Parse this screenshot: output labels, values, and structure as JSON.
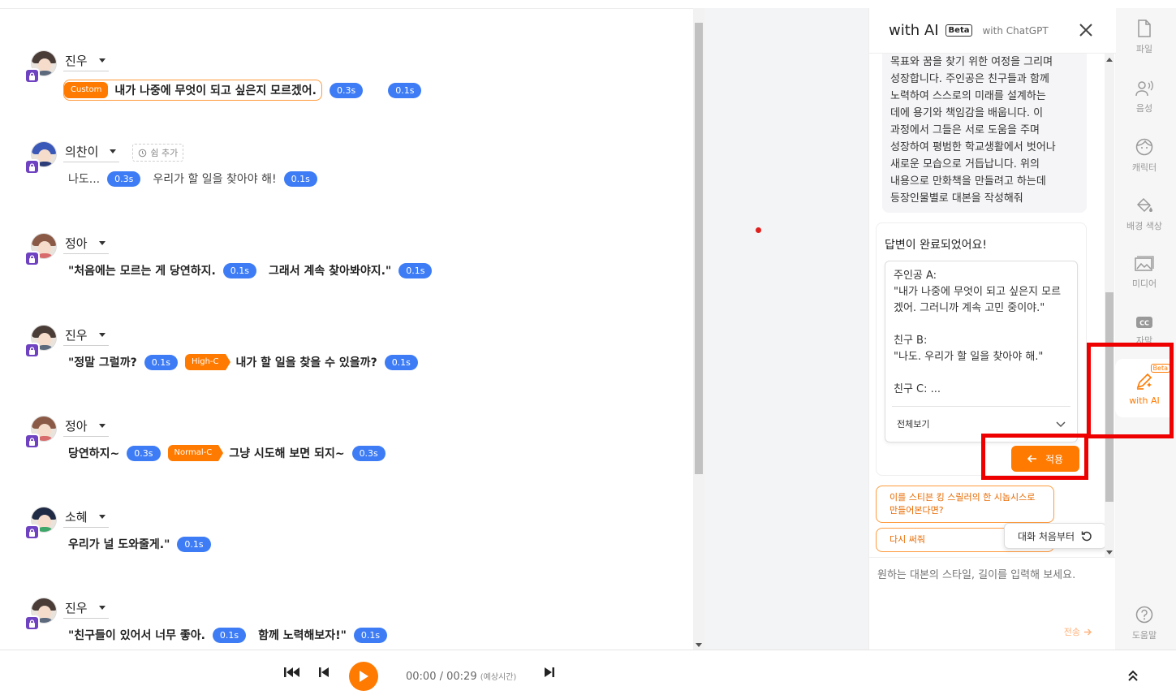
{
  "editor": {
    "lines": [
      {
        "speaker": "진우",
        "segments": [
          {
            "tag": "Custom",
            "text": "내가 나중에 무엇이 되고 싶은지 모르겠어.",
            "pause": "0.3s"
          }
        ],
        "trailing_pause": "0.1s"
      },
      {
        "speaker": "의찬이",
        "add_rest": "쉼 추가",
        "segments": [
          {
            "text": "나도...",
            "pause": "0.3s"
          },
          {
            "text": "우리가 할 일을 찾아야 해!",
            "pause": "0.1s"
          }
        ]
      },
      {
        "speaker": "정아",
        "segments": [
          {
            "text": "\"처음에는 모르는 게 당연하지.",
            "pause": "0.1s"
          },
          {
            "text": "그래서 계속 찾아봐야지.\"",
            "pause": "0.1s"
          }
        ]
      },
      {
        "speaker": "진우",
        "segments": [
          {
            "text": "\"정말 그럴까?",
            "pause": "0.1s"
          },
          {
            "tag": "High-C",
            "text": "내가 할 일을 찾을 수 있을까?",
            "pause": "0.1s"
          }
        ]
      },
      {
        "speaker": "정아",
        "segments": [
          {
            "text": "당연하지~",
            "pause": "0.3s"
          },
          {
            "tag": "Normal-C",
            "text": "그냥 시도해 보면 되지~",
            "pause": "0.3s"
          }
        ]
      },
      {
        "speaker": "소혜",
        "segments": [
          {
            "text": "우리가 널 도와줄게.\"",
            "pause": "0.1s"
          }
        ]
      },
      {
        "speaker": "진우",
        "segments": [
          {
            "text": "\"친구들이 있어서 너무 좋아.",
            "pause": "0.1s"
          },
          {
            "text": "함께 노력해보자!\"",
            "pause": "0.1s"
          }
        ]
      }
    ]
  },
  "ai_panel": {
    "title": "with AI",
    "beta": "Beta",
    "subtitle": "with ChatGPT",
    "user_prompt_lines": [
      "목표와 꿈을 찾기 위한 여정을 그리며",
      "성장합니다. 주인공은 친구들과 함께",
      "노력하여 스스로의 미래를 설계하는",
      "데에 용기와 책임감을 배웁니다. 이",
      "과정에서 그들은 서로 도움을 주며",
      "성장하여 평범한 학교생활에서 벗어나",
      "새로운 모습으로 거듭납니다. 위의",
      "내용으로 만화책을 만들려고 하는데",
      "등장인물별로 대본을 작성해줘"
    ],
    "answer_head": "답변이 완료되었어요!",
    "answer_text": "주인공 A:\n\"내가 나중에 무엇이 되고 싶은지 모르겠어. 그러니까 계속 고민 중이야.\"\n\n친구 B:\n\"나도. 우리가 할 일을 찾아야 해.\"\n\n친구 C: ...",
    "view_all": "전체보기",
    "apply": "적용",
    "suggestion_1": "이를 스티븐 킹 스릴러의 한 시놉시스로 만들어본다면?",
    "suggestion_2": "다시 써줘",
    "reset": "대화 처음부터",
    "input_placeholder": "원하는 대본의 스타일, 길이를 입력해 보세요.",
    "send": "전송"
  },
  "toolbar": {
    "items": [
      {
        "label": "파일",
        "icon": "file-icon"
      },
      {
        "label": "음성",
        "icon": "voice-icon"
      },
      {
        "label": "캐릭터",
        "icon": "character-icon"
      },
      {
        "label": "배경 색상",
        "icon": "paint-bucket-icon"
      },
      {
        "label": "미디어",
        "icon": "image-icon"
      },
      {
        "label": "자막",
        "icon": "cc-icon"
      },
      {
        "label": "with AI",
        "icon": "ai-pen-icon",
        "badge": "Beta"
      },
      {
        "label": "도움말",
        "icon": "help-icon"
      }
    ]
  },
  "player": {
    "time_current": "00:00",
    "time_total": "00:29",
    "time_note": "(예상시간)"
  },
  "colors": {
    "accent": "#ff7a00",
    "pause_pill": "#3d7cf5",
    "lock": "#6f42c1",
    "highlight": "#ee0000"
  }
}
